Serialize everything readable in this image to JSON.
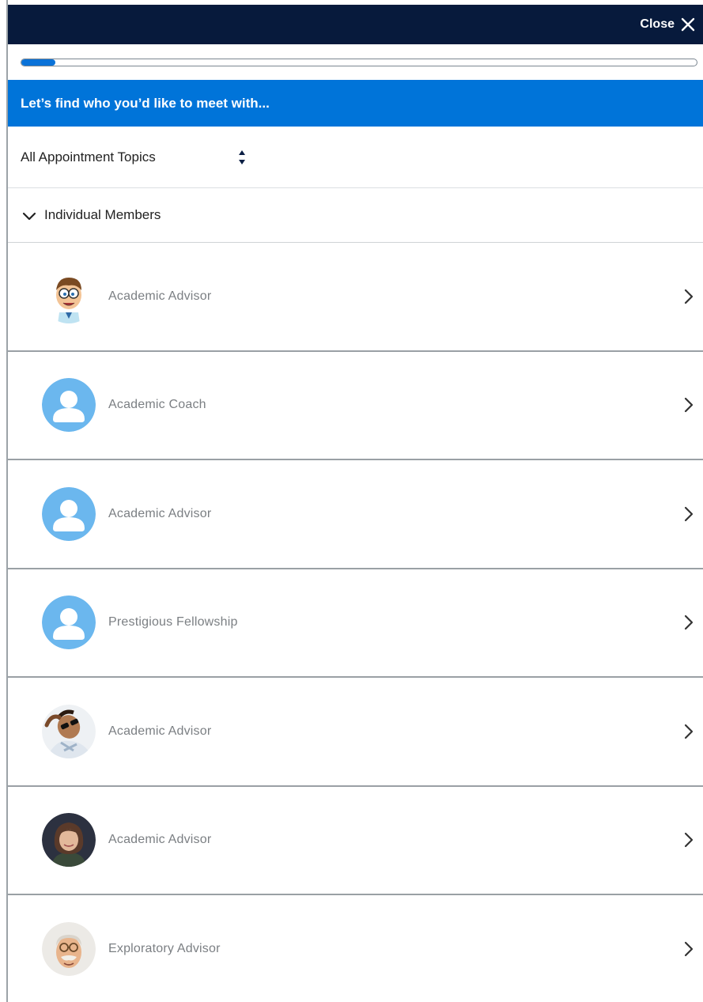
{
  "header": {
    "close_label": "Close",
    "close_icon": "close-icon"
  },
  "progress": {
    "percent": 5
  },
  "banner": {
    "text": "Let’s find who you’d like to meet with..."
  },
  "topic_filter": {
    "selected": "All Appointment Topics"
  },
  "group": {
    "label": "Individual Members"
  },
  "members": [
    {
      "role": "Academic Advisor",
      "avatar": "cartoon-man"
    },
    {
      "role": "Academic Coach",
      "avatar": "placeholder"
    },
    {
      "role": "Academic Advisor",
      "avatar": "placeholder"
    },
    {
      "role": "Prestigious Fellowship",
      "avatar": "placeholder"
    },
    {
      "role": "Academic Advisor",
      "avatar": "photo-sunglasses"
    },
    {
      "role": "Academic Advisor",
      "avatar": "photo-woman"
    },
    {
      "role": "Exploratory Advisor",
      "avatar": "cartoon-old-man"
    }
  ],
  "colors": {
    "topbar": "#071a3c",
    "banner": "#0074d9",
    "progress": "#0a72d8",
    "placeholder_avatar": "#6bb7ee"
  }
}
